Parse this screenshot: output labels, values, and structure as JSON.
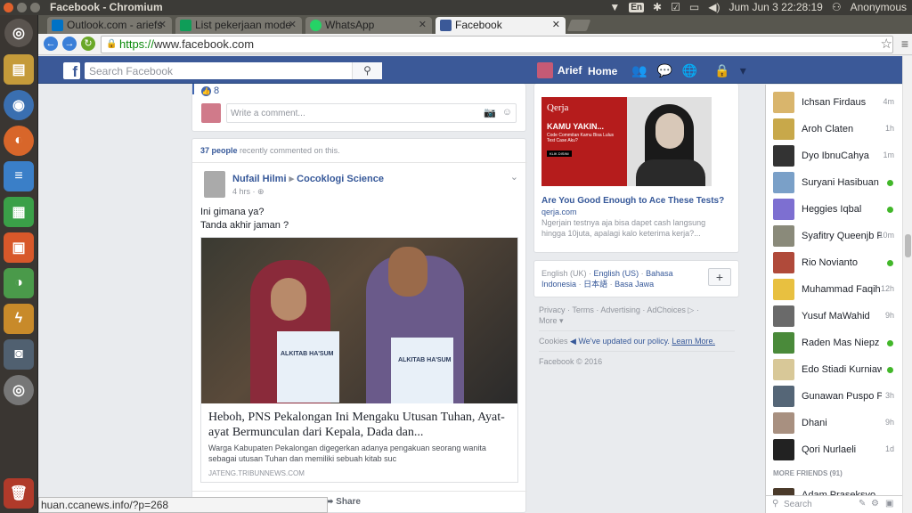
{
  "os": {
    "window_title": "Facebook - Chromium",
    "lang": "En",
    "clock": "Jum Jun  3 22:28:19",
    "user": "Anonymous"
  },
  "browser": {
    "tabs": [
      {
        "label": "Outlook.com - ariefs",
        "icon_color": "#0072c6"
      },
      {
        "label": "List pekerjaan mode",
        "icon_color": "#0f9d58"
      },
      {
        "label": "WhatsApp",
        "icon_color": "#25d366"
      },
      {
        "label": "Facebook",
        "icon_color": "#3b5998"
      }
    ],
    "url_scheme": "https://",
    "url_rest": "www.facebook.com",
    "status_url": "huan.ccanews.info/?p=268"
  },
  "fb": {
    "search_placeholder": "Search Facebook",
    "user_name": "Arief",
    "home_label": "Home"
  },
  "post_top": {
    "like_count": "8",
    "comment_placeholder": "Write a comment..."
  },
  "post": {
    "commented_count": "37 people",
    "commented_text": "recently commented on this.",
    "author": "Nufail Hilmi",
    "group": "Cocoklogi Science",
    "time": "4 hrs",
    "text_line1": "Ini gimana ya?",
    "text_line2": "Tanda akhir jaman ?",
    "photo_book1": "ALKITAB HA'SUM",
    "photo_book2": "ALKITAB HA'SUM",
    "link_title": "Heboh, PNS Pekalongan Ini Mengaku Utusan Tuhan, Ayat-ayat Bermunculan dari Kepala, Dada dan...",
    "link_desc": "Warga Kabupaten Pekalongan digegerkan adanya pengakuan seorang wanita sebagai utusan Tuhan dan memiliki sebuah kitab suc",
    "link_domain": "JATENG.TRIBUNNEWS.COM",
    "share_label": "Share"
  },
  "ad": {
    "brand": "Qerja",
    "banner_title": "KAMU YAKIN...",
    "banner_sub": "Code Commitan Kamu Bisa Lulus Test Case Aku?",
    "banner_btn": "KLIK DISINI",
    "title": "Are You Good Enough to Ace These Tests?",
    "domain": "qerja.com",
    "desc": "Ngerjain testnya aja bisa dapet cash langsung hingga 10juta, apalagi kalo keterima kerja?..."
  },
  "lang_box": {
    "current": "English (UK)",
    "dot1": "·",
    "lang1": "English (US)",
    "dot2": "·",
    "lang2": "Bahasa Indonesia",
    "dot3": "·",
    "lang3": "日本語",
    "dot4": "·",
    "lang4": "Basa Jawa",
    "add": "+"
  },
  "footer": {
    "links": "Privacy · Terms · Advertising · AdChoices",
    "more": "More",
    "cookies": "Cookies",
    "cookies_update": "◀ We've updated our policy.",
    "learn_more": "Learn More.",
    "copyright": "Facebook © 2016"
  },
  "chat": {
    "friends": [
      {
        "name": "Ichsan Firdaus",
        "time": "4m",
        "color": "#d9b56c"
      },
      {
        "name": "Aroh Claten",
        "time": "1h",
        "color": "#c8a84a"
      },
      {
        "name": "Dyo IbnuCahya",
        "time": "1m",
        "color": "#333333"
      },
      {
        "name": "Suryani Hasibuan",
        "online": true,
        "color": "#7aa0c8"
      },
      {
        "name": "Heggies Iqbal",
        "online": true,
        "color": "#7d6fd1"
      },
      {
        "name": "Syafitry Queenjb Pra...",
        "time": "10m",
        "color": "#8a8a7a"
      },
      {
        "name": "Rio Novianto",
        "online": true,
        "color": "#b04a3a"
      },
      {
        "name": "Muhammad Faqih Za...",
        "time": "12h",
        "color": "#e8c040"
      },
      {
        "name": "Yusuf MaWahid",
        "time": "9h",
        "color": "#6a6a6a"
      },
      {
        "name": "Raden Mas Niepz",
        "online": true,
        "color": "#4a8a3a"
      },
      {
        "name": "Edo Stiadi Kurniawan",
        "online": true,
        "color": "#d8c898"
      },
      {
        "name": "Gunawan Puspo Pra...",
        "time": "3h",
        "color": "#556677"
      },
      {
        "name": "Dhani",
        "time": "9h",
        "color": "#a89080"
      },
      {
        "name": "Qori Nurlaeli",
        "time": "1d",
        "color": "#222222"
      }
    ],
    "more_friends": "MORE FRIENDS (91)",
    "partial_friend": "Adam Praseksyo",
    "search_placeholder": "Search"
  }
}
